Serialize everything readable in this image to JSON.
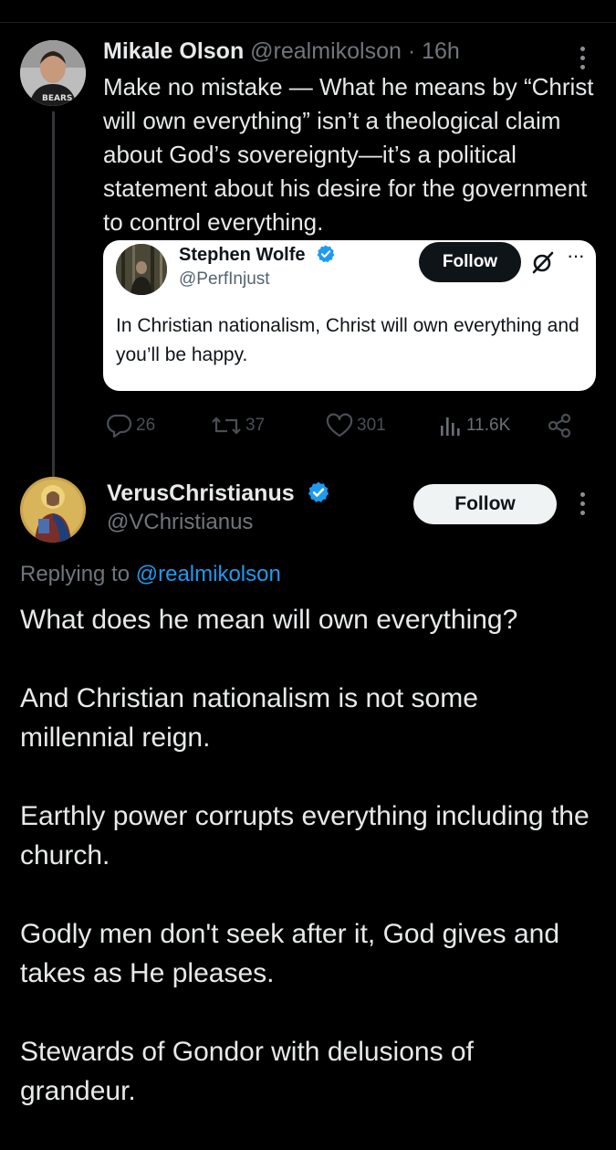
{
  "tweet1": {
    "author_name": "Mikale Olson",
    "handle": "@realmikolson",
    "separator": "·",
    "time": "16h",
    "text": "Make no mistake — What he means by “Christ will own everything” isn’t a theological claim about God’s sovereignty—it’s a political statement about his desire for the government to control everything.",
    "quoted": {
      "author_name": "Stephen Wolfe",
      "handle": "@PerfInjust",
      "follow_label": "Follow",
      "more_label": "···",
      "text": "In Christian nationalism, Christ will own everything and you’ll be happy."
    },
    "actions": {
      "replies": "26",
      "reposts": "37",
      "likes": "301",
      "views": "11.6K"
    }
  },
  "tweet2": {
    "author_name": "VerusChristianus",
    "handle": "@VChristianus",
    "follow_label": "Follow",
    "replying_prefix": "Replying to",
    "replying_to": "@realmikolson",
    "paragraphs": [
      "What does he mean will own everything?",
      "And Christian nationalism is not some millennial reign.",
      "Earthly power corrupts everything including the church.",
      "Godly men don't seek after it, God gives and takes as He pleases.",
      "Stewards of Gondor with delusions of grandeur."
    ]
  },
  "icons": {
    "verified": "verified-badge-icon",
    "grok": "grok-icon",
    "reply": "reply-icon",
    "repost": "repost-icon",
    "like": "like-icon",
    "views": "views-icon",
    "share": "share-icon",
    "more": "more-vertical-icon"
  },
  "colors": {
    "background": "#000000",
    "text": "#e7e9ea",
    "muted": "#71767b",
    "accent": "#1d9bf0",
    "card": "#ffffff"
  }
}
